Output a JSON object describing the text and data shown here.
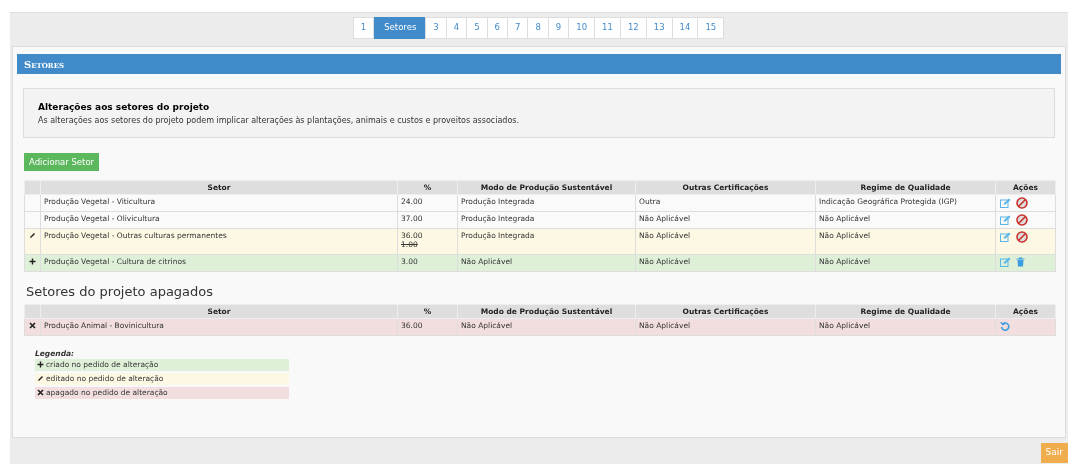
{
  "pagination": [
    {
      "label": "1",
      "selected": false
    },
    {
      "label": "Setores",
      "selected": true
    },
    {
      "label": "3",
      "selected": false
    },
    {
      "label": "4",
      "selected": false
    },
    {
      "label": "5",
      "selected": false
    },
    {
      "label": "6",
      "selected": false
    },
    {
      "label": "7",
      "selected": false
    },
    {
      "label": "8",
      "selected": false
    },
    {
      "label": "9",
      "selected": false
    },
    {
      "label": "10",
      "selected": false
    },
    {
      "label": "11",
      "selected": false
    },
    {
      "label": "12",
      "selected": false
    },
    {
      "label": "13",
      "selected": false
    },
    {
      "label": "14",
      "selected": false
    },
    {
      "label": "15",
      "selected": false
    }
  ],
  "panel": {
    "title": "Setores",
    "info": {
      "title": "Alterações aos setores do projeto",
      "text": "As alterações aos setores do projeto podem implicar alterações às plantações, animais e custos e proveitos associados."
    },
    "add_button": "Adicionar Setor",
    "table": {
      "columns": [
        "Setor",
        "%",
        "Modo de Produção Sustentável",
        "Outras Certificações",
        "Regime de Qualidade",
        "Ações"
      ],
      "rows": [
        {
          "kind": "unchanged",
          "cells": [
            "Produção Vegetal - Viticultura",
            "24.00",
            "Produção Integrada",
            "Outra",
            "Indicação Geográfica Protegida (IGP)"
          ],
          "actions": [
            {
              "kind": "edit"
            },
            {
              "kind": "disable"
            }
          ]
        },
        {
          "kind": "unchanged",
          "cells": [
            "Produção Vegetal - Olivicultura",
            "37.00",
            "Produção Integrada",
            "Não Aplicável",
            "Não Aplicável"
          ],
          "actions": [
            {
              "kind": "edit"
            },
            {
              "kind": "disable"
            }
          ]
        },
        {
          "kind": "edited",
          "cells": [
            "Produção Vegetal - Outras culturas permanentes",
            "36.00",
            "Produção Integrada",
            "Não Aplicável",
            "Não Aplicável"
          ],
          "previous_percent": "1.00",
          "actions": [
            {
              "kind": "edit"
            },
            {
              "kind": "disable"
            }
          ]
        },
        {
          "kind": "created",
          "cells": [
            "Produção Vegetal - Cultura de citrinos",
            "3.00",
            "Não Aplicável",
            "Não Aplicável",
            "Não Aplicável"
          ],
          "actions": [
            {
              "kind": "edit"
            },
            {
              "kind": "delete"
            }
          ]
        }
      ]
    },
    "deleted_heading": "Setores do projeto apagados",
    "deleted_table": {
      "columns": [
        "Setor",
        "%",
        "Modo de Produção Sustentável",
        "Outras Certificações",
        "Regime de Qualidade",
        "Ações"
      ],
      "rows": [
        {
          "kind": "deleted",
          "cells": [
            "Produção Animal - Bovinicultura",
            "36.00",
            "Não Aplicável",
            "Não Aplicável",
            "Não Aplicável"
          ],
          "actions": [
            {
              "kind": "restore"
            }
          ]
        }
      ]
    },
    "legend": {
      "title": "Legenda:",
      "items": [
        {
          "kind": "created",
          "text": "criado no pedido de alteração"
        },
        {
          "kind": "edited",
          "text": "editado no pedido de alteração"
        },
        {
          "kind": "deleted",
          "text": "apagado no pedido de alteração"
        }
      ]
    }
  },
  "exit_button": "Sair"
}
